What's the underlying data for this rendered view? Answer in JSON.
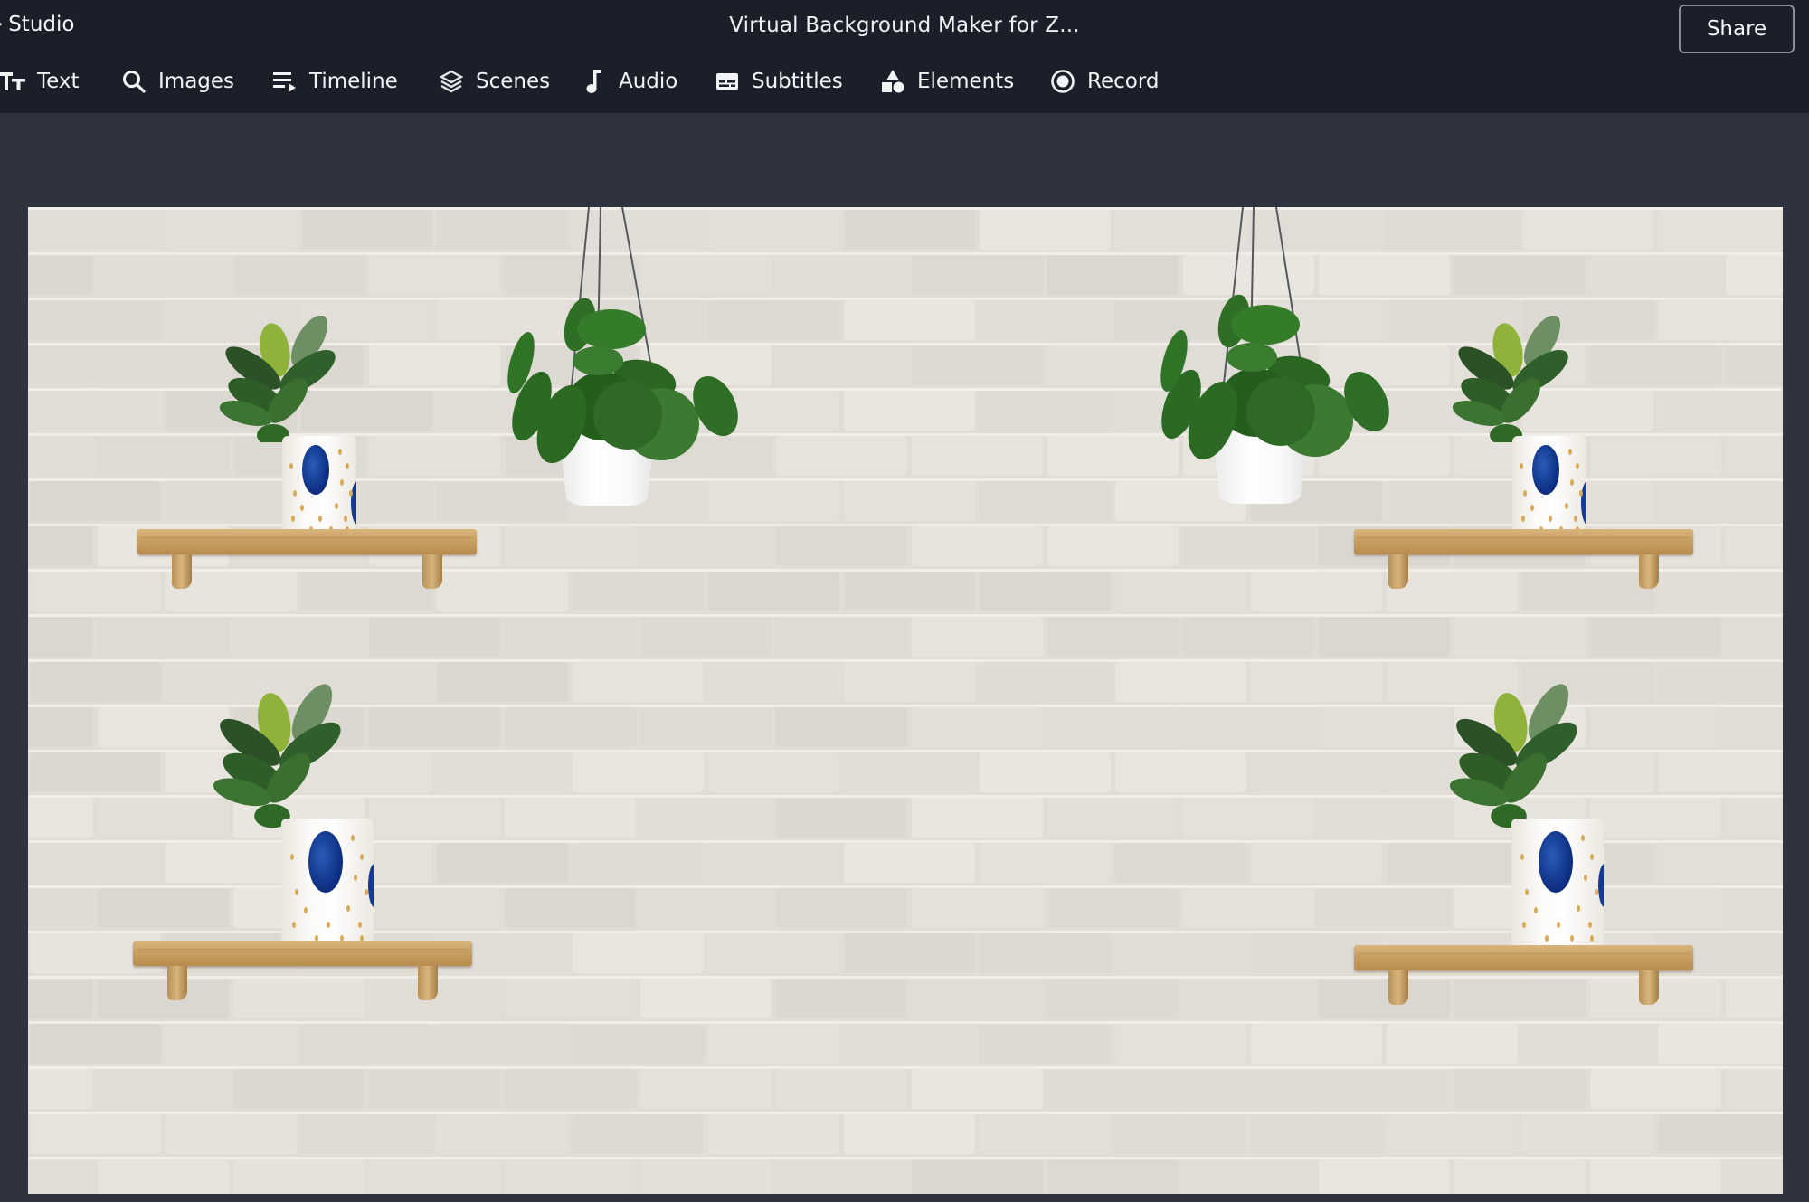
{
  "header": {
    "back_label": "Studio",
    "back_icon": "chevron-left-icon",
    "title": "Virtual Background Maker for Z...",
    "share_label": "Share"
  },
  "toolbar": {
    "items": [
      {
        "label": "Text",
        "icon": "text-size-icon"
      },
      {
        "label": "Images",
        "icon": "search-icon"
      },
      {
        "label": "Timeline",
        "icon": "playlist-icon"
      },
      {
        "label": "Scenes",
        "icon": "layers-icon"
      },
      {
        "label": "Audio",
        "icon": "music-note-icon"
      },
      {
        "label": "Subtitles",
        "icon": "subtitles-icon"
      },
      {
        "label": "Elements",
        "icon": "shapes-icon"
      },
      {
        "label": "Record",
        "icon": "record-icon"
      }
    ]
  },
  "canvas": {
    "background": "white brick wall",
    "elements": [
      {
        "type": "shelf-with-fiddle-leaf-plant",
        "position": "top-left"
      },
      {
        "type": "hanging-pilea-plant",
        "position": "top-center-left"
      },
      {
        "type": "hanging-pilea-plant",
        "position": "top-center-right"
      },
      {
        "type": "shelf-with-fiddle-leaf-plant",
        "position": "top-right"
      },
      {
        "type": "shelf-with-fiddle-leaf-plant",
        "position": "bottom-left"
      },
      {
        "type": "shelf-with-fiddle-leaf-plant",
        "position": "bottom-right"
      }
    ]
  },
  "colors": {
    "header_bg": "#1a1f2a",
    "workspace_bg": "#2f333f",
    "wall": "#e1dcd5",
    "leaf_green": "#2f6b2a",
    "pot_blue": "#0b2c7f",
    "wood": "#c89f62"
  }
}
